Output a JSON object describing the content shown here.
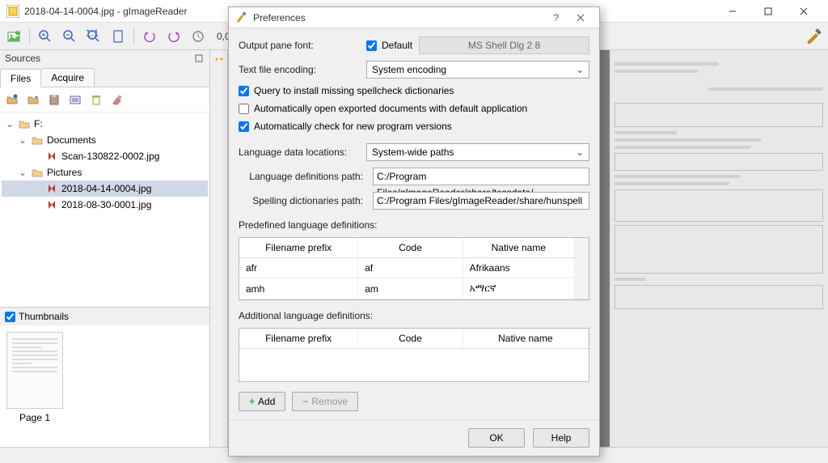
{
  "window": {
    "title": "2018-04-14-0004.jpg - gImageReader",
    "zoom": "0,0"
  },
  "sources": {
    "header": "Sources",
    "tabs": {
      "files": "Files",
      "acquire": "Acquire"
    },
    "tree": {
      "root": "F:",
      "documents": "Documents",
      "scan1": "Scan-130822-0002.jpg",
      "pictures": "Pictures",
      "pic1": "2018-04-14-0004.jpg",
      "pic2": "2018-08-30-0001.jpg"
    }
  },
  "thumbnails": {
    "header": "Thumbnails",
    "page1": "Page 1"
  },
  "dialog": {
    "title": "Preferences",
    "output_font_label": "Output pane font:",
    "default_label": "Default",
    "font_value": "MS Shell Dlg 2 8",
    "encoding_label": "Text file encoding:",
    "encoding_value": "System encoding",
    "chk_spell": "Query to install missing spellcheck dictionaries",
    "chk_open": "Automatically open exported documents with default application",
    "chk_update": "Automatically check for new program versions",
    "lang_loc_label": "Language data locations:",
    "lang_loc_value": "System-wide paths",
    "lang_def_label": "Language definitions path:",
    "lang_def_value": "C:/Program Files/gImageReader/share/tessdata/",
    "spell_dict_label": "Spelling dictionaries path:",
    "spell_dict_value": "C:/Program Files/gImageReader/share/hunspell",
    "predef_label": "Predefined language definitions:",
    "addl_label": "Additional language definitions:",
    "col_prefix": "Filename prefix",
    "col_code": "Code",
    "col_native": "Native name",
    "rows": [
      {
        "prefix": "afr",
        "code": "af",
        "native": "Afrikaans"
      },
      {
        "prefix": "amh",
        "code": "am",
        "native": "አማርኛ"
      }
    ],
    "add": "Add",
    "remove": "Remove",
    "ok": "OK",
    "help": "Help"
  }
}
